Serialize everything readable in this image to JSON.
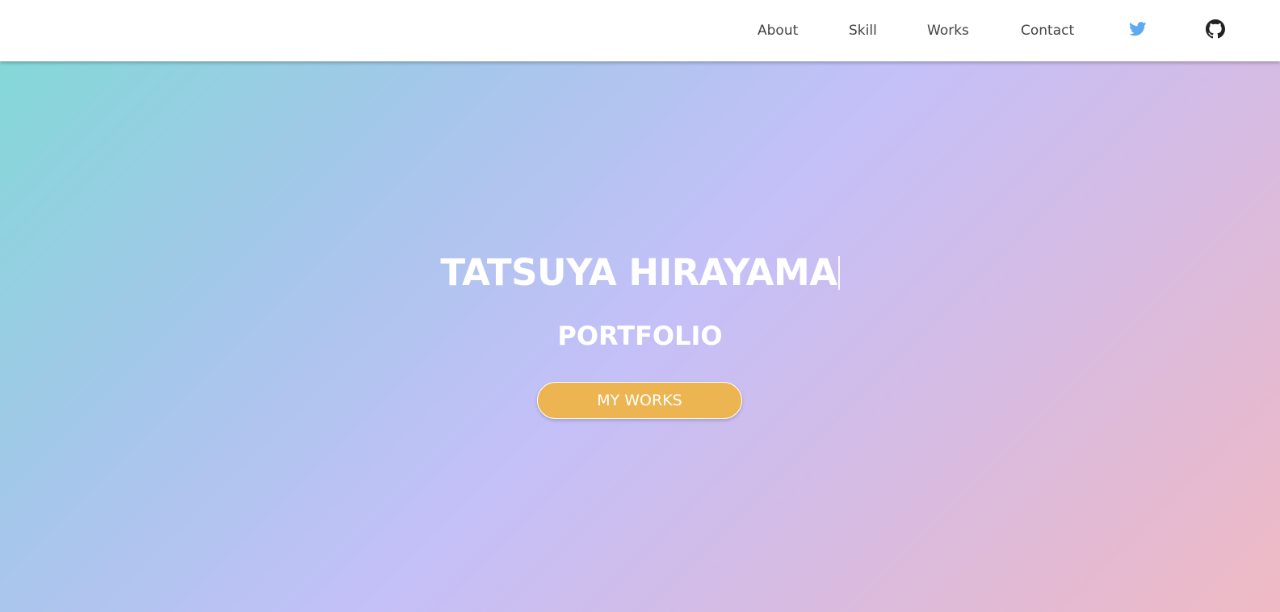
{
  "header": {
    "nav": [
      "About",
      "Skill",
      "Works",
      "Contact"
    ],
    "icons": {
      "twitter": "twitter-icon",
      "github": "github-icon"
    }
  },
  "hero": {
    "title": "TATSUYA HIRAYAMA",
    "subtitle": "PORTFOLIO",
    "button_label": "MY WORKS"
  },
  "colors": {
    "header_bg": "#ffffff",
    "nav_text": "#444444",
    "twitter_blue": "#5ea9f0",
    "github_black": "#222222",
    "button_bg": "#ecb552",
    "gradient_start": "#84d8d8",
    "gradient_mid": "#c4c0f8",
    "gradient_end": "#f0bac4"
  }
}
